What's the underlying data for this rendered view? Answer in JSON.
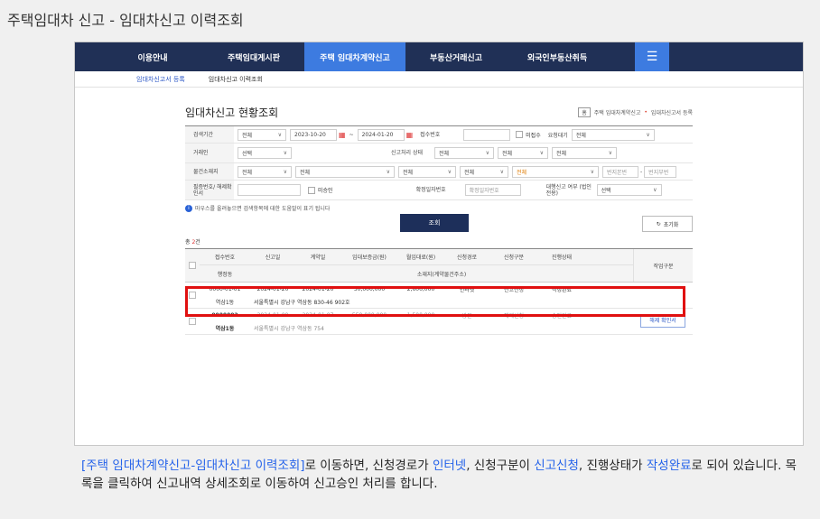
{
  "page_title": "주택임대차 신고 - 임대차신고 이력조회",
  "gnb": {
    "items": [
      "이용안내",
      "주택임대게시판",
      "주택 임대차계약신고",
      "부동산거래신고",
      "외국인부동산취득"
    ],
    "menu_icon": "☰"
  },
  "subnav": {
    "items": [
      "임대차신고서 등록",
      "임대차신고 이력조회"
    ]
  },
  "heading": "임대차신고 현황조회",
  "breadcrumb": {
    "home": "홈",
    "item1": "주택 임대차계약신고",
    "item2": "임대차신고서 등록"
  },
  "form": {
    "search_period_label": "검색기간",
    "search_period_value": "전체",
    "date_from": "2023-10-20",
    "date_sep": "~",
    "date_to": "2024-01-20",
    "receipt_no_label": "접수번호",
    "unreceived_label": "미접수",
    "request_wait_label": "요청대기",
    "request_wait_value": "전체",
    "trader_label": "거래인",
    "trader_value": "선택",
    "status_label": "신고처리 상태",
    "status_values": [
      "전체",
      "전체",
      "전체"
    ],
    "location_label": "물건소재지",
    "location_values": [
      "전체",
      "전체",
      "전체",
      "전체",
      "전체"
    ],
    "bunji_main": "번지본번",
    "bunji_dash": "-",
    "bunji_sub": "번지부번",
    "confirm_no_label": "필증번호/ 해제확인서",
    "unapproved_label": "미승인",
    "fixed_date_label": "확정일자번호",
    "fixed_date_placeholder": "확정일자번호",
    "agent_label": "대행신고 여부 (법인전용)",
    "agent_value": "선택"
  },
  "help_text": "마우스를 올려놓으면 검색항목에 대한 도움말이 표기 됩니다",
  "search_button": "조회",
  "reset_button": "초기화",
  "total": {
    "prefix": "총 ",
    "count": "2",
    "suffix": "건"
  },
  "table": {
    "headers": [
      "접수번호",
      "신고일",
      "계약일",
      "임대보증금(원)",
      "월임대료(원)",
      "신청경로",
      "신청구분",
      "진행상태"
    ],
    "header_dong": "행정동",
    "header_addr": "소재지(계약물건주소)",
    "header_work": "작업구분",
    "rows": [
      {
        "receipt_no": "0000-01-01",
        "report_date": "2024-01-20",
        "contract_date": "2024-01-20",
        "deposit": "50,000,000",
        "rent": "2,600,000",
        "route": "인터넷",
        "type": "신고신청",
        "status": "작성완료",
        "dong": "역삼1동",
        "address": "서울특별시 강남구 역삼동 830-46 902호",
        "action": ""
      },
      {
        "receipt_no": "0000002",
        "report_date": "2024-01-09",
        "contract_date": "2024-01-07",
        "deposit": "550,000,000",
        "rent": "1,500,000",
        "route": "방문",
        "type": "해제신청",
        "status": "승인완료",
        "dong": "역삼1동",
        "address": "서울특별시 강남구 역삼동 754",
        "action": "해제 확인서"
      }
    ]
  },
  "caption": {
    "p1": "[주택 임대차계약신고-임대차신고 이력조회]",
    "p2": "로 이동하면, 신청경로가 ",
    "p3": "인터넷",
    "p4": ", 신청구분이 ",
    "p5": "신고신청",
    "p6": ", 진행상태가 ",
    "p7": "작성완료",
    "p8": "로 되어 있습니다. 목록을 클릭하여 신고내역 상세조회로 이동하여 신고승인 처리를 합니다."
  },
  "colors": {
    "nav_bg": "#203056",
    "nav_active": "#3d7be0",
    "highlight": "#e01010",
    "link": "#2462ea"
  }
}
